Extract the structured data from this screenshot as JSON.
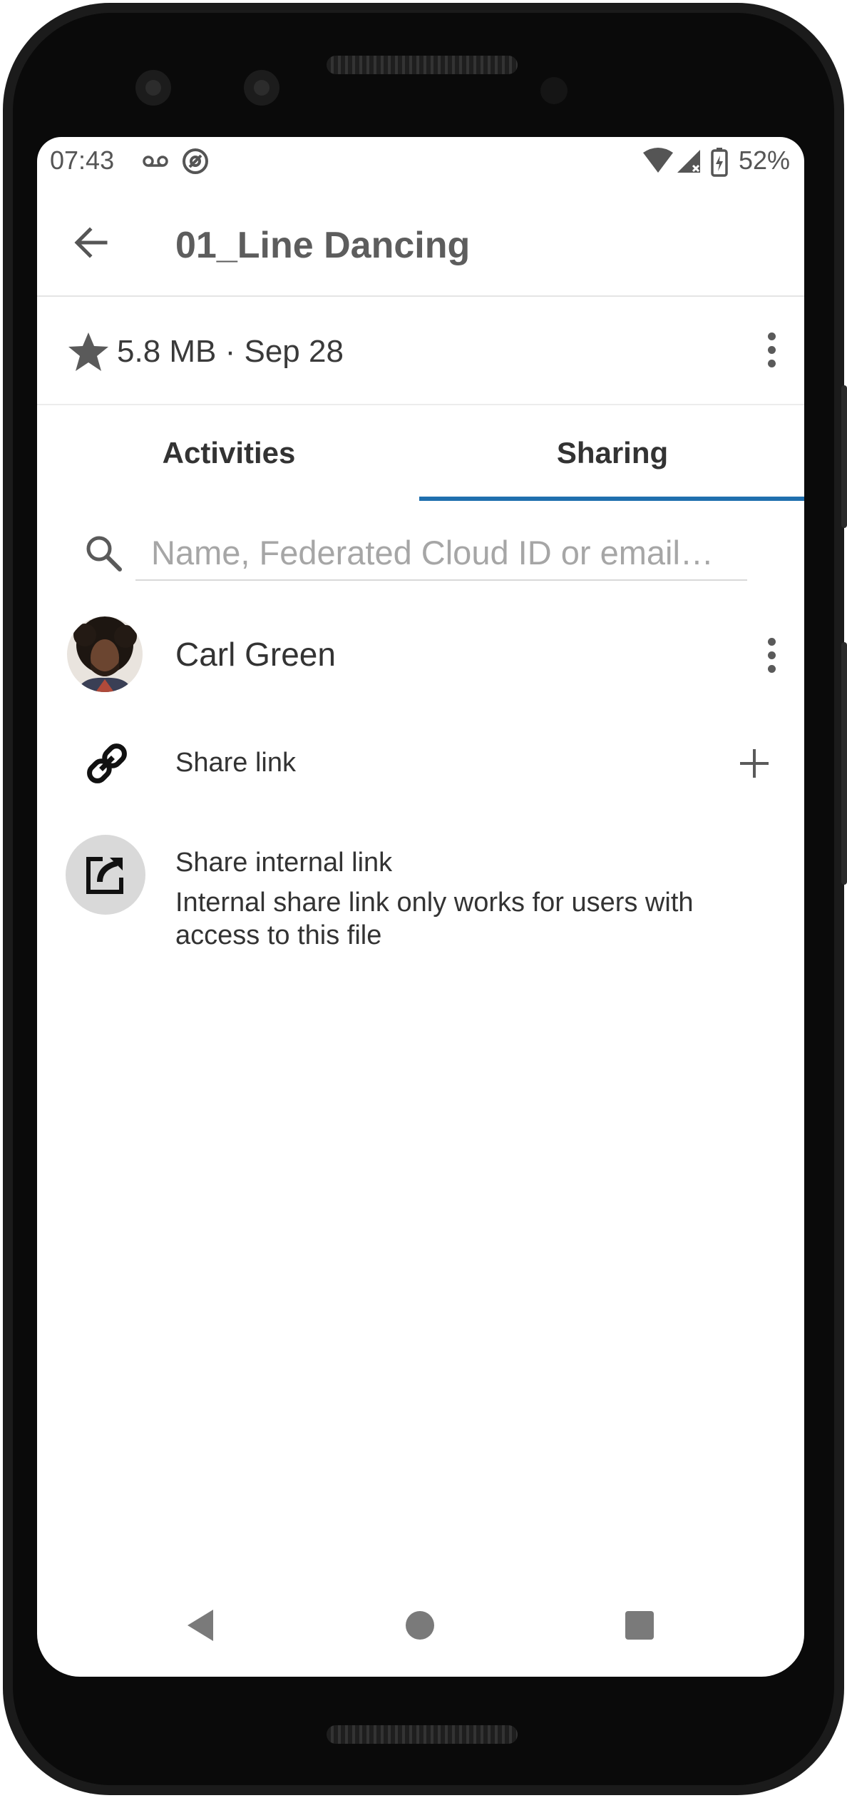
{
  "status_bar": {
    "time": "07:43",
    "battery": "52%",
    "icons": [
      "voicemail-icon",
      "at-sign-icon",
      "wifi-icon",
      "signal-icon",
      "battery-charging-icon"
    ]
  },
  "app_bar": {
    "title": "01_Line Dancing",
    "back_icon": "arrow-back-icon"
  },
  "file_info": {
    "meta": "5.8 MB · Sep 28",
    "favorite_icon": "star-icon",
    "overflow_icon": "more-vert-icon"
  },
  "tabs": [
    {
      "label": "Activities",
      "selected": false
    },
    {
      "label": "Sharing",
      "selected": true
    }
  ],
  "search": {
    "placeholder": "Name, Federated Cloud ID or email…",
    "value": "",
    "icon": "search-icon"
  },
  "shares": {
    "user": {
      "name": "Carl Green",
      "avatar": "user-avatar",
      "overflow_icon": "more-vert-icon"
    },
    "share_link": {
      "label": "Share link",
      "icon": "link-icon",
      "action_icon": "plus-icon"
    },
    "internal_link": {
      "label": "Share internal link",
      "description": "Internal share link only works for users with access to this file",
      "icon": "open-in-new-icon"
    }
  },
  "nav_bar": {
    "buttons": [
      "back-triangle-icon",
      "home-circle-icon",
      "recents-square-icon"
    ]
  },
  "colors": {
    "accent": "#1f6fae",
    "text_primary": "#333333",
    "placeholder": "#a6a6a6",
    "icon_gray": "#5a5a5a"
  }
}
